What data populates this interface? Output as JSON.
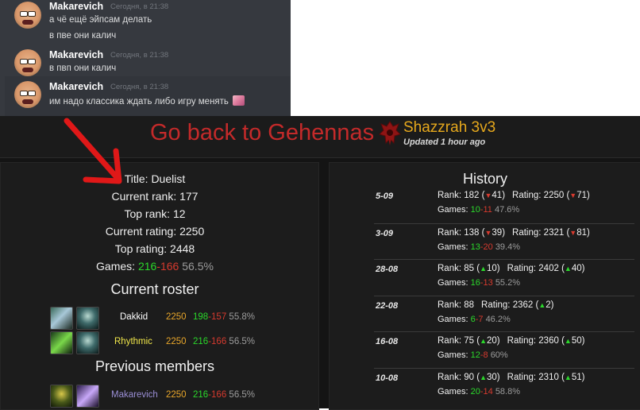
{
  "chat": {
    "messages": [
      {
        "author": "Makarevich",
        "time": "Сегодня, в 21:38",
        "lines": [
          "а чё ещё эйпсам делать",
          "в пве они калич"
        ]
      },
      {
        "author": "Makarevich",
        "time": "Сегодня, в 21:38",
        "lines": [
          "в пвп они калич"
        ]
      },
      {
        "author": "Makarevich",
        "time": "Сегодня, в 21:38",
        "lines": [
          "им надо классика ждать либо игру менять"
        ]
      }
    ]
  },
  "header": {
    "back_link": "Go back to Gehennas",
    "team_name": "Shazzrah 3v3",
    "updated": "Updated 1 hour ago",
    "accent_color": "#c42a2a"
  },
  "stats": {
    "title": "Title: Duelist",
    "current_rank": "Current rank: 177",
    "top_rank": "Top rank: 12",
    "current_rating": "Current rating: 2250",
    "top_rating": "Top rating: 2448",
    "games_label": "Games:",
    "wins": "216",
    "losses": "166",
    "winrate": "56.5%"
  },
  "roster": {
    "title": "Current roster",
    "members": [
      {
        "name": "Dakkid",
        "rating": "2250",
        "wins": "198",
        "losses": "157",
        "pct": "55.8%",
        "name_color": "#ffffff"
      },
      {
        "name": "Rhythmic",
        "rating": "2250",
        "wins": "216",
        "losses": "166",
        "pct": "56.5%",
        "name_color": "#f0e64a"
      }
    ]
  },
  "previous": {
    "title": "Previous members",
    "members": [
      {
        "name": "Makarevich",
        "rating": "2250",
        "wins": "216",
        "losses": "166",
        "pct": "56.5%",
        "name_color": "#9b8fd6"
      }
    ]
  },
  "history": {
    "title": "History",
    "rows": [
      {
        "date": "5-09",
        "rank": "182",
        "rank_dir": "down",
        "rank_delta": "41",
        "rating": "2250",
        "rating_dir": "down",
        "rating_delta": "71",
        "wins": "10",
        "losses": "11",
        "pct": "47.6%"
      },
      {
        "date": "3-09",
        "rank": "138",
        "rank_dir": "down",
        "rank_delta": "39",
        "rating": "2321",
        "rating_dir": "down",
        "rating_delta": "81",
        "wins": "13",
        "losses": "20",
        "pct": "39.4%"
      },
      {
        "date": "28-08",
        "rank": "85",
        "rank_dir": "up",
        "rank_delta": "10",
        "rating": "2402",
        "rating_dir": "up",
        "rating_delta": "40",
        "wins": "16",
        "losses": "13",
        "pct": "55.2%"
      },
      {
        "date": "22-08",
        "rank": "88",
        "rank_dir": "",
        "rank_delta": "",
        "rating": "2362",
        "rating_dir": "up",
        "rating_delta": "2",
        "wins": "6",
        "losses": "7",
        "pct": "46.2%"
      },
      {
        "date": "16-08",
        "rank": "75",
        "rank_dir": "up",
        "rank_delta": "20",
        "rating": "2360",
        "rating_dir": "up",
        "rating_delta": "50",
        "wins": "12",
        "losses": "8",
        "pct": "60%"
      },
      {
        "date": "10-08",
        "rank": "90",
        "rank_dir": "up",
        "rank_delta": "30",
        "rating": "2310",
        "rating_dir": "up",
        "rating_delta": "51",
        "wins": "20",
        "losses": "14",
        "pct": "58.8%"
      }
    ]
  }
}
